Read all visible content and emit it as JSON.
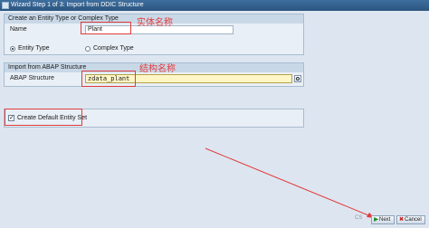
{
  "window": {
    "title": "Wizard Step 1 of 3: Import from DDIC Structure"
  },
  "entity_panel": {
    "header": "Create an Entity Type or Complex Type",
    "name_label": "Name",
    "name_value": "Plant",
    "radio_entity_type": "Entity Type",
    "radio_complex_type": "Complex Type",
    "selected": "Entity Type"
  },
  "import_panel": {
    "header": "Import from ABAP Structure",
    "structure_label": "ABAP Structure",
    "structure_value": "zdata_plant"
  },
  "default_set": {
    "label": "Create Default Entity Set",
    "checked": true,
    "check_mark": "✓"
  },
  "annotations": {
    "entity_name": "实体名称",
    "structure_name": "结构名称",
    "color": "#e23b3b"
  },
  "footer": {
    "watermark": "CS",
    "next_label": "Next",
    "next_glyph": "▶",
    "cancel_label": "Cancel",
    "cancel_glyph": "✖"
  }
}
